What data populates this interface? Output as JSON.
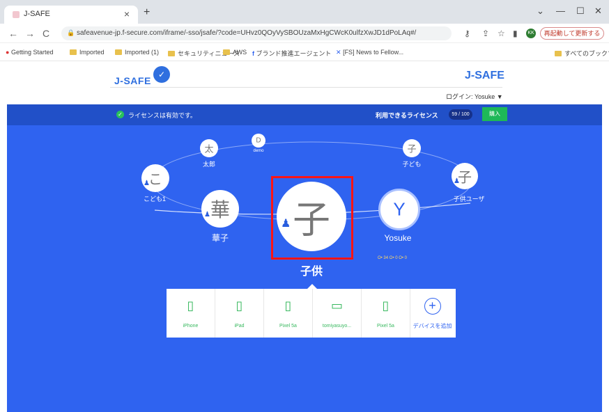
{
  "browser": {
    "tab_title": "J-SAFE",
    "url": "safeavenue-jp.f-secure.com/iframe/-sso/jsafe/?code=UHvz0QOyVySBOUzaMxHgCWcK0ulfzXwJD1dPoLAq#/",
    "update_button": "再起動して更新する",
    "bookmarks": [
      "Getting Started",
      "Imported",
      "Imported (1)",
      "セキュリティニュース",
      "AWS",
      "ブランド推進エージェント",
      "[FS] News to Fellow...",
      "すべてのブックマーク"
    ]
  },
  "header": {
    "logo_left": "J-SAFE",
    "logo_right": "J-SAFE",
    "login": "ログイン: Yosuke ▼"
  },
  "license": {
    "status": "ライセンスは有効です。",
    "available_label": "利用できるライセンス",
    "count": "59 / 100",
    "buy": "購入"
  },
  "profiles": [
    {
      "glyph": "太",
      "label": "太郎"
    },
    {
      "glyph": "D",
      "label": "demo"
    },
    {
      "glyph": "子",
      "label": "子ども"
    },
    {
      "glyph": "こ",
      "label": "こども1"
    },
    {
      "glyph": "子",
      "label": "子供ユーザ"
    },
    {
      "glyph": "華",
      "label": "華子"
    },
    {
      "glyph": "子",
      "label": "子供"
    },
    {
      "glyph": "Y",
      "label": "Yosuke"
    }
  ],
  "yosuke_status": "O• 34 O• 0 O• 0",
  "devices": [
    {
      "name": "iPhone"
    },
    {
      "name": "iPad"
    },
    {
      "name": "Pixel 5a"
    },
    {
      "name": "tomiyasuyo..."
    },
    {
      "name": "Pixel 5a"
    }
  ],
  "add_device": "デバイスを追加",
  "colors": {
    "brand": "#2f63f0",
    "selection": "#ff1515",
    "green": "#37b85e"
  }
}
